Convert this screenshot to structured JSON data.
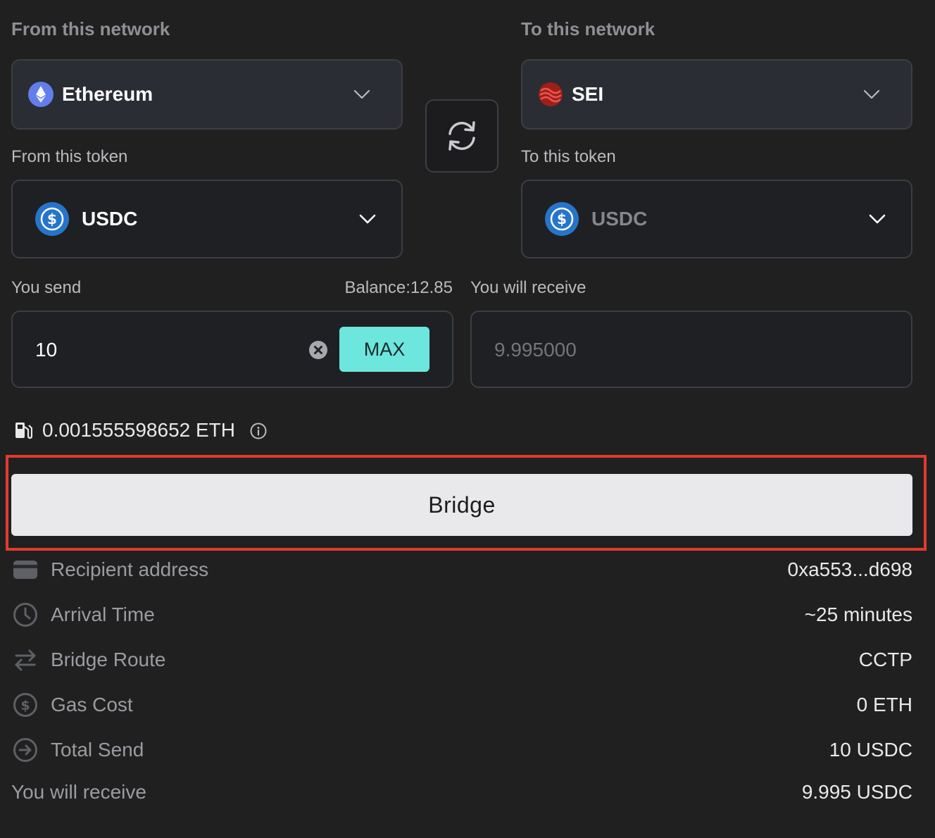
{
  "from_network": {
    "section_label": "From this network",
    "selected": "Ethereum",
    "icon": "ethereum-icon"
  },
  "to_network": {
    "section_label": "To this network",
    "selected": "SEI",
    "icon": "sei-icon"
  },
  "from_token": {
    "label": "From this token",
    "selected": "USDC",
    "icon": "usdc-icon"
  },
  "to_token": {
    "label": "To this token",
    "selected": "USDC",
    "icon": "usdc-icon"
  },
  "send": {
    "label": "You send",
    "balance": "Balance:12.85",
    "value": "10",
    "max_label": "MAX"
  },
  "receive": {
    "label": "You will receive",
    "placeholder": "9.995000"
  },
  "gas_estimate": {
    "value": "0.001555598652 ETH",
    "icon": "gas-pump-icon"
  },
  "bridge_button": {
    "label": "Bridge"
  },
  "details": {
    "recipient": {
      "label": "Recipient address",
      "value": "0xa553...d698",
      "icon": "wallet-icon"
    },
    "arrival": {
      "label": "Arrival Time",
      "value": "~25 minutes",
      "icon": "clock-icon"
    },
    "route": {
      "label": "Bridge Route",
      "value": "CCTP",
      "icon": "swap-arrows-icon"
    },
    "gas": {
      "label": "Gas Cost",
      "value": "0 ETH",
      "icon": "dollar-circle-icon"
    },
    "total": {
      "label": "Total Send",
      "value": "10 USDC",
      "icon": "arrow-right-circle-icon"
    },
    "receive": {
      "label": "You will receive",
      "value": "9.995 USDC"
    }
  },
  "colors": {
    "background": "#202020",
    "accent": "#6de6dd",
    "highlight": "#e23a30",
    "usdc": "#2775ca",
    "ethereum": "#627eea",
    "sei": "#9e1f19"
  }
}
